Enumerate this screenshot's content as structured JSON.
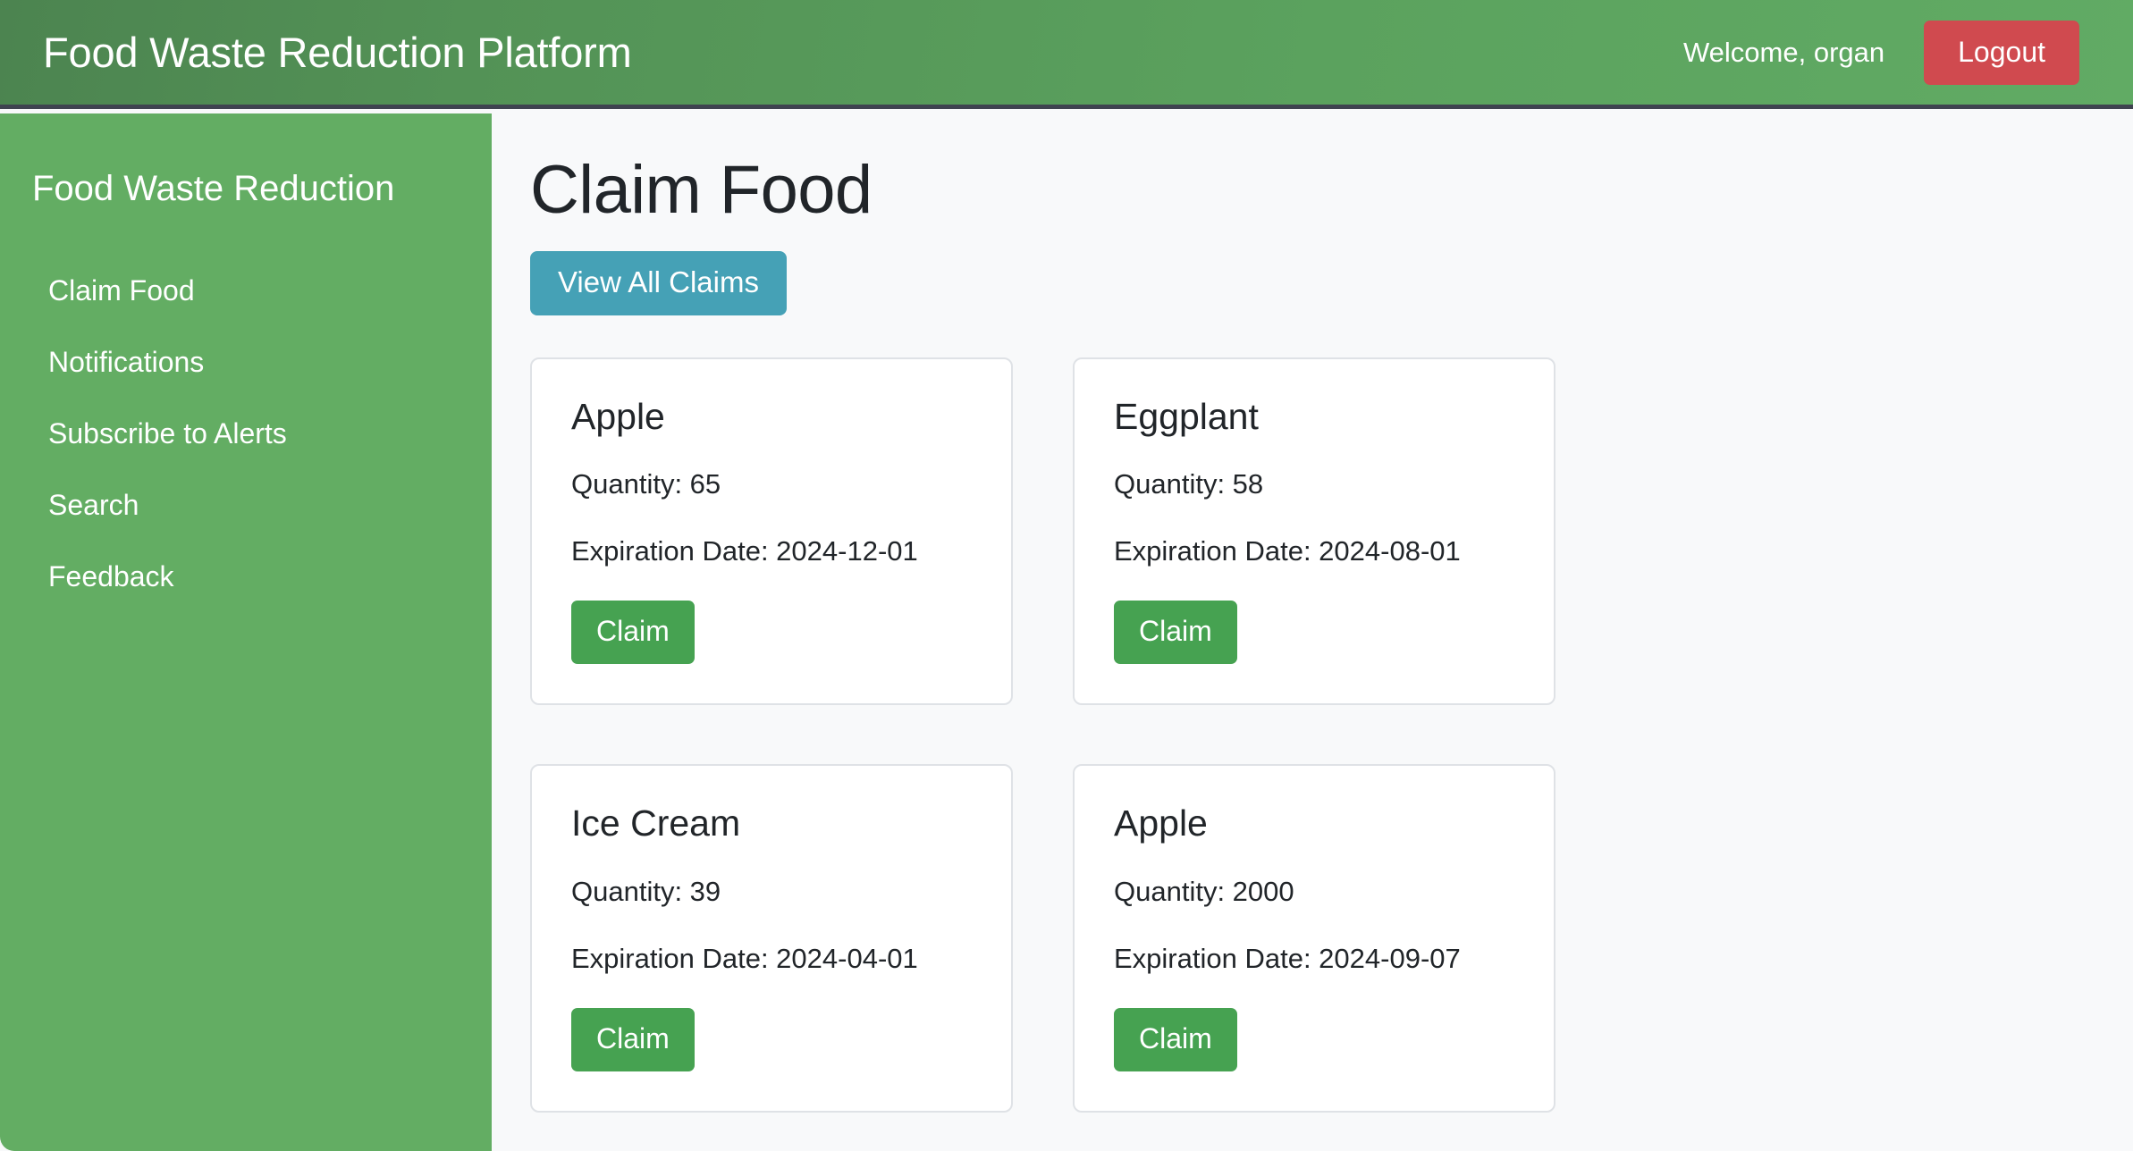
{
  "header": {
    "app_title": "Food Waste Reduction Platform",
    "welcome_text": "Welcome, organ",
    "logout_label": "Logout",
    "bg_color_start": "#4c8450",
    "bg_color_end": "#61ab64",
    "logout_color": "#d04a4f"
  },
  "sidebar": {
    "brand": "Food Waste Reduction",
    "bg_color": "#63ad63",
    "items": [
      {
        "label": "Claim Food"
      },
      {
        "label": "Notifications"
      },
      {
        "label": "Subscribe to Alerts"
      },
      {
        "label": "Search"
      },
      {
        "label": "Feedback"
      }
    ]
  },
  "main": {
    "page_title": "Claim Food",
    "view_all_claims_label": "View All Claims",
    "view_all_claims_color": "#45a1b6",
    "claim_button_color": "#46a251",
    "labels": {
      "quantity_prefix": "Quantity: ",
      "expiration_prefix": "Expiration Date: ",
      "claim_label": "Claim"
    },
    "cards": [
      {
        "name": "Apple",
        "quantity": "Quantity: 65",
        "expiration": "Expiration Date: 2024-12-01",
        "claim_label": "Claim"
      },
      {
        "name": "Eggplant",
        "quantity": "Quantity: 58",
        "expiration": "Expiration Date: 2024-08-01",
        "claim_label": "Claim"
      },
      {
        "name": "Ice Cream",
        "quantity": "Quantity: 39",
        "expiration": "Expiration Date: 2024-04-01",
        "claim_label": "Claim"
      },
      {
        "name": "Apple",
        "quantity": "Quantity: 2000",
        "expiration": "Expiration Date: 2024-09-07",
        "claim_label": "Claim"
      }
    ]
  }
}
